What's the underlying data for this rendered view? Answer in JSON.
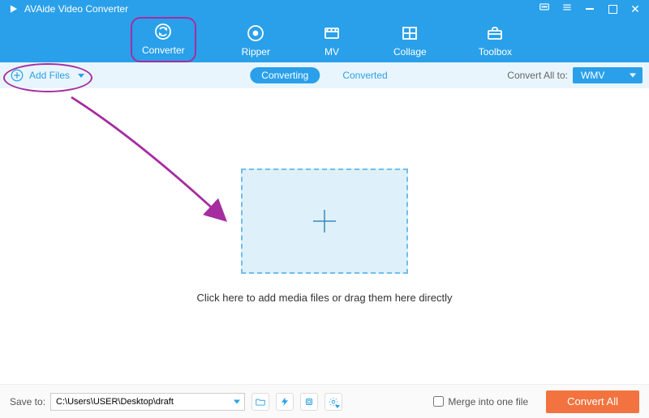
{
  "app": {
    "title": "AVAide Video Converter"
  },
  "nav": {
    "items": [
      {
        "label": "Converter"
      },
      {
        "label": "Ripper"
      },
      {
        "label": "MV"
      },
      {
        "label": "Collage"
      },
      {
        "label": "Toolbox"
      }
    ]
  },
  "subbar": {
    "add_files": "Add Files",
    "tab_converting": "Converting",
    "tab_converted": "Converted",
    "convert_all_to_label": "Convert All to:",
    "format_selected": "WMV"
  },
  "main": {
    "drop_text": "Click here to add media files or drag them here directly"
  },
  "footer": {
    "save_to_label": "Save to:",
    "path": "C:\\Users\\USER\\Desktop\\draft",
    "merge_label": "Merge into one file",
    "convert_button": "Convert All"
  }
}
